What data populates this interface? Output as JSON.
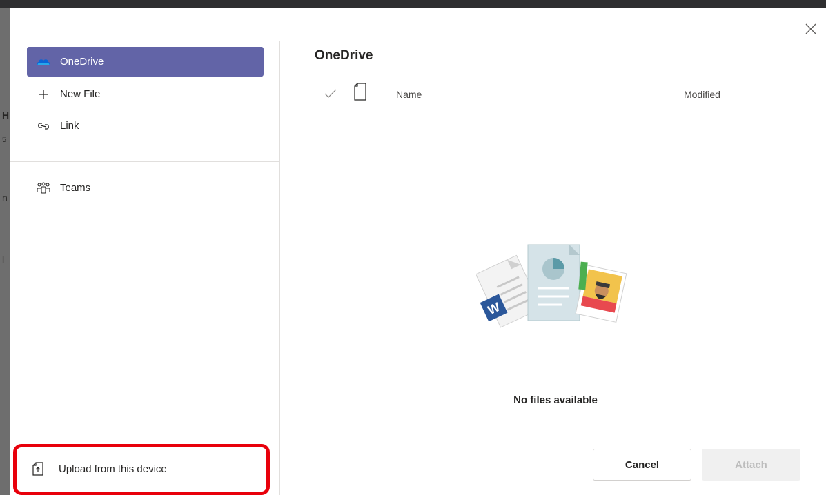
{
  "colors": {
    "accent": "#6264a7",
    "highlight_border": "#e8000b",
    "topbar": "#2e2e30",
    "backdrop": "#6e6e6e"
  },
  "sidebar": {
    "items": [
      {
        "label": "OneDrive",
        "icon": "onedrive-cloud-icon",
        "active": true
      },
      {
        "label": "New File",
        "icon": "plus-icon"
      },
      {
        "label": "Link",
        "icon": "link-icon"
      },
      {
        "label": "Teams",
        "icon": "teams-icon"
      }
    ],
    "upload": {
      "label": "Upload from this device",
      "icon": "upload-file-icon"
    }
  },
  "main": {
    "title": "OneDrive",
    "columns": {
      "name": "Name",
      "modified": "Modified"
    },
    "empty_message": "No files available"
  },
  "footer": {
    "cancel_label": "Cancel",
    "attach_label": "Attach"
  },
  "backdrop_text": [
    "H",
    "5",
    "n",
    "l"
  ]
}
